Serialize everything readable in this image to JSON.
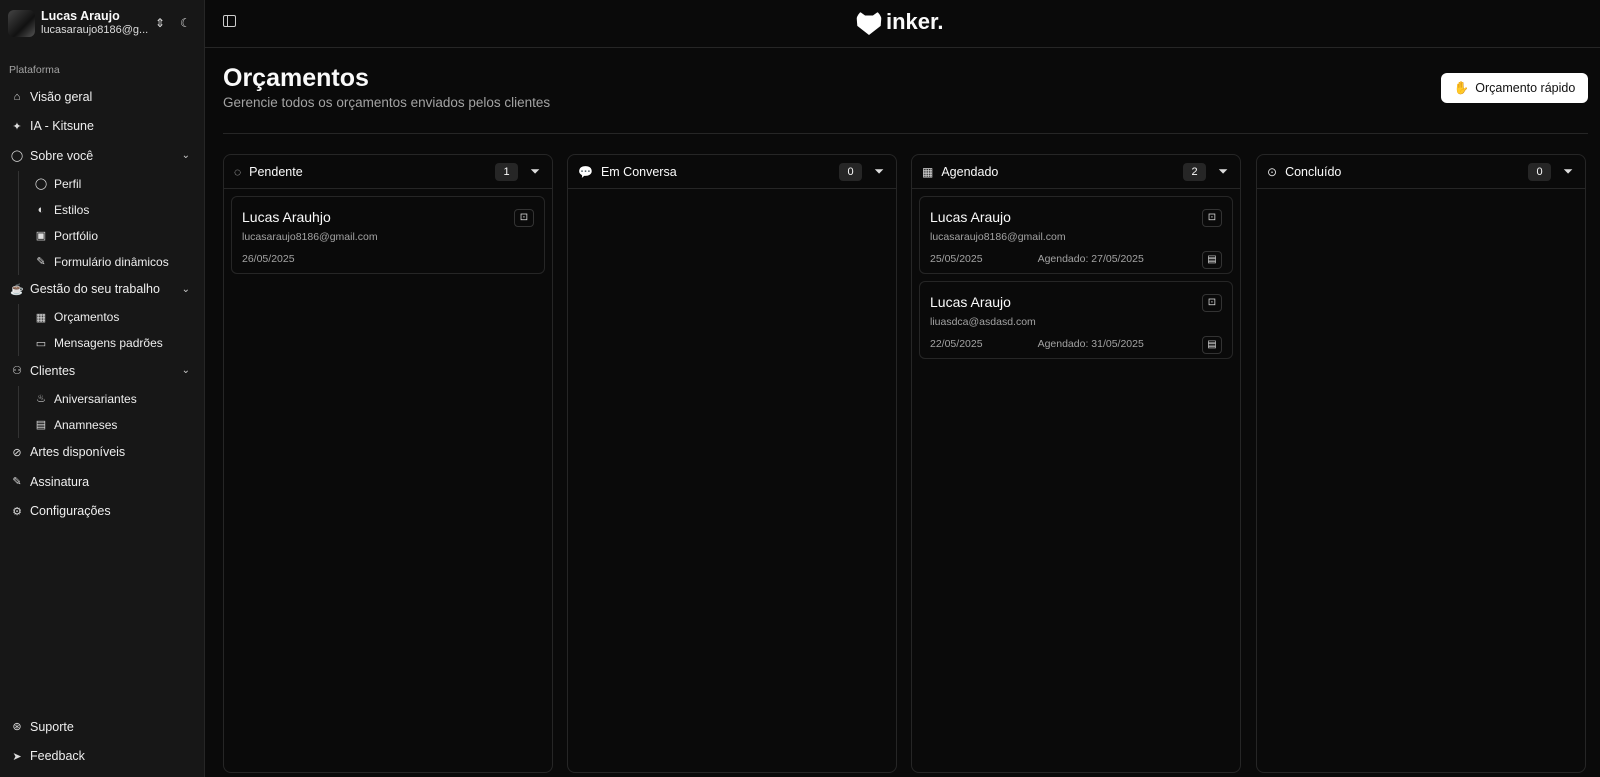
{
  "user": {
    "name": "Lucas Araujo",
    "email": "lucasaraujo8186@g..."
  },
  "sidebar": {
    "group_label": "Plataforma",
    "items": [
      {
        "label": "Visão geral",
        "icon": "home-icon"
      },
      {
        "label": "IA - Kitsune",
        "icon": "sparkles-icon"
      },
      {
        "label": "Sobre você",
        "icon": "user-icon",
        "children": [
          {
            "label": "Perfil"
          },
          {
            "label": "Estilos"
          },
          {
            "label": "Portfólio"
          },
          {
            "label": "Formulário dinâmicos"
          }
        ]
      },
      {
        "label": "Gestão do seu trabalho",
        "icon": "coffee-icon",
        "children": [
          {
            "label": "Orçamentos"
          },
          {
            "label": "Mensagens padrões"
          }
        ]
      },
      {
        "label": "Clientes",
        "icon": "users-icon",
        "children": [
          {
            "label": "Aniversariantes"
          },
          {
            "label": "Anamneses"
          }
        ]
      },
      {
        "label": "Artes disponíveis",
        "icon": "compass-icon"
      },
      {
        "label": "Assinatura",
        "icon": "signature-icon"
      },
      {
        "label": "Configurações",
        "icon": "settings-icon"
      }
    ],
    "bottom": [
      {
        "label": "Suporte",
        "icon": "lifebuoy-icon"
      },
      {
        "label": "Feedback",
        "icon": "send-icon"
      }
    ]
  },
  "header": {
    "logo": "inker."
  },
  "page": {
    "title": "Orçamentos",
    "subtitle": "Gerencie todos os orçamentos enviados pelos clientes",
    "quick_button": "Orçamento rápido"
  },
  "columns": [
    {
      "title": "Pendente",
      "icon": "loader-dashed-icon",
      "count": "1",
      "cards": [
        {
          "name": "Lucas Arauhjo",
          "email": "lucasaraujo8186@gmail.com",
          "date": "26/05/2025"
        }
      ]
    },
    {
      "title": "Em Conversa",
      "icon": "message-circle-icon",
      "count": "0",
      "cards": []
    },
    {
      "title": "Agendado",
      "icon": "calendar-check-icon",
      "count": "2",
      "cards": [
        {
          "name": "Lucas Araujo",
          "email": "lucasaraujo8186@gmail.com",
          "date": "25/05/2025",
          "scheduled": "Agendado: 27/05/2025"
        },
        {
          "name": "Lucas Araujo",
          "email": "liuasdca@asdasd.com",
          "date": "22/05/2025",
          "scheduled": "Agendado: 31/05/2025"
        }
      ]
    },
    {
      "title": "Concluído",
      "icon": "check-circle-icon",
      "count": "0",
      "cards": []
    }
  ]
}
